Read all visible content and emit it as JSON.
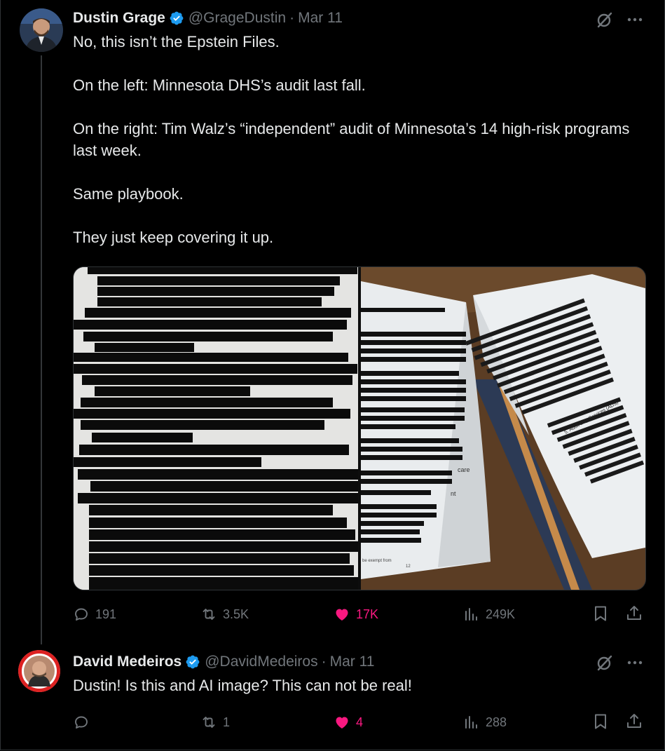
{
  "colors": {
    "accent": "#1d9bf0",
    "like": "#f91880",
    "muted": "#71767b",
    "text": "#e7e9ea"
  },
  "posts": [
    {
      "name": "Dustin Grage",
      "handle": "@GrageDustin",
      "separator": "·",
      "date": "Mar 11",
      "verified": true,
      "paragraphs": [
        "No, this isn’t the Epstein Files.",
        "On the left: Minnesota DHS’s audit last fall.",
        "On the right: Tim Walz’s “independent” audit of Minnesota’s 14 high-risk programs last week.",
        "Same playbook.",
        "They just keep covering it up."
      ],
      "media_text": {
        "left_label": "",
        "right_labels": [
          "care",
          "nt",
          "5. Adult Day Services (ADS)",
          "be exempt from",
          "12"
        ]
      },
      "stats": {
        "replies": "191",
        "reposts": "3.5K",
        "likes": "17K",
        "views": "249K",
        "liked": true
      },
      "icons": [
        "grok-icon",
        "more-icon",
        "reply-icon",
        "repost-icon",
        "heart-icon",
        "views-icon",
        "bookmark-icon",
        "share-icon"
      ]
    },
    {
      "name": "David Medeiros",
      "handle": "@DavidMedeiros",
      "separator": "·",
      "date": "Mar 11",
      "verified": true,
      "text": "Dustin! Is this and AI image? This can not be real!",
      "stats": {
        "replies": "",
        "reposts": "1",
        "likes": "4",
        "views": "288",
        "liked": true
      }
    }
  ]
}
